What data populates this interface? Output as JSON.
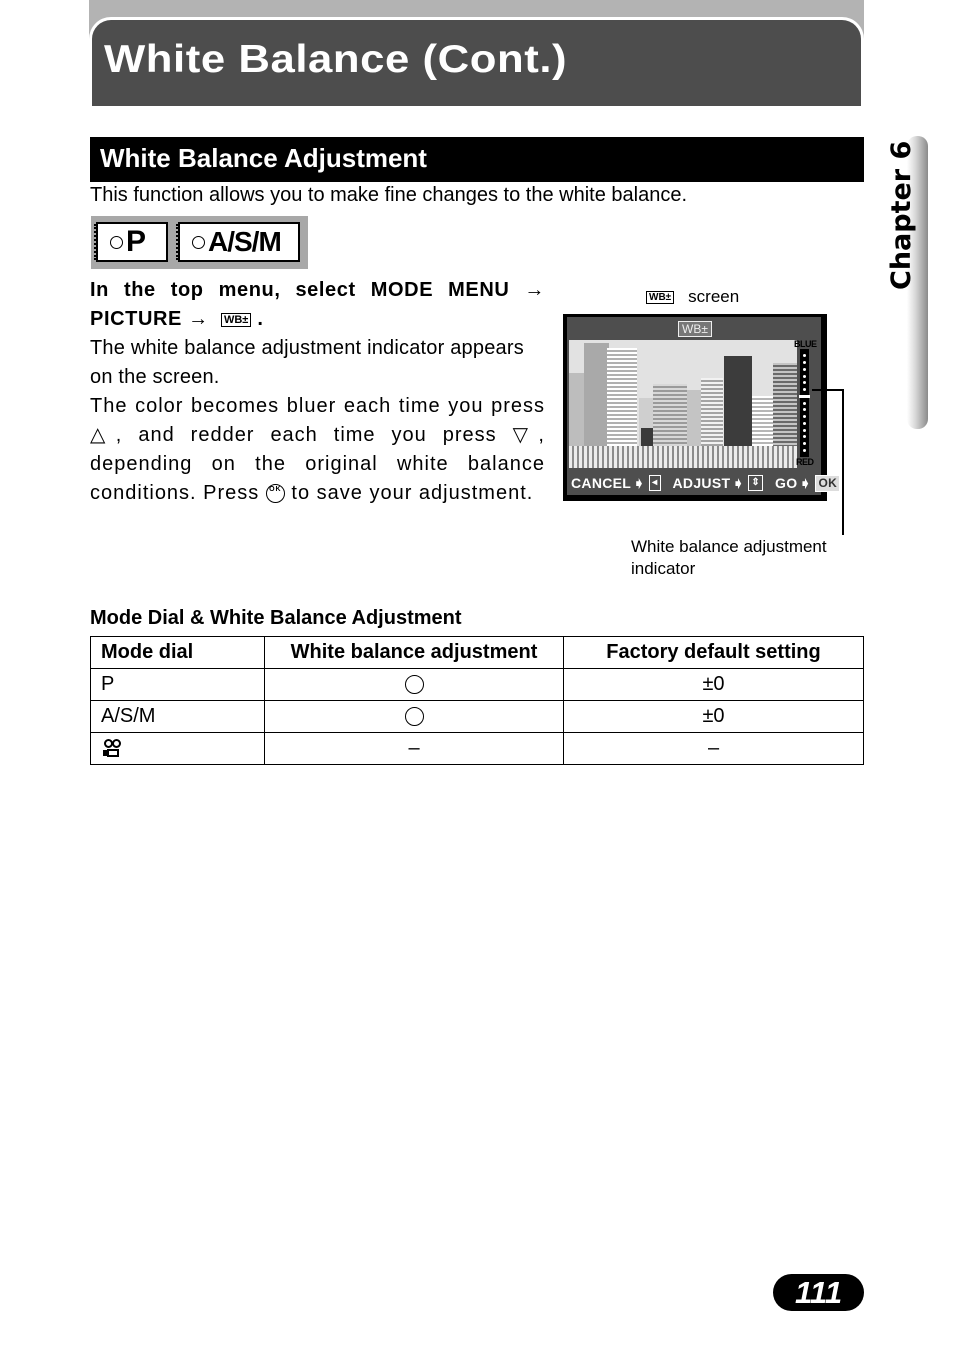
{
  "header": {
    "title": "White Balance (Cont.)"
  },
  "section": {
    "heading": "White Balance Adjustment",
    "intro": "This function allows you to make fine changes to the white balance."
  },
  "modes": {
    "badges": [
      "P",
      "A/S/M"
    ]
  },
  "instructions": {
    "line1": "In the top menu, select MODE MENU",
    "line2": "PICTURE",
    "arrow": "→",
    "period": ".",
    "wb_icon_label": "WB±",
    "para1": "The white balance adjustment indicator appears on the screen.",
    "para2_a": "The color becomes bluer each time you press",
    "up_triangle": "△",
    "para2_b": ", and redder each time you press",
    "down_triangle": "▽",
    "para2_c": ", depending on the original white balance conditions. Press",
    "ok_icon_label": "OK",
    "para2_d": "to save your adjustment."
  },
  "figure": {
    "caption_icon": "WB±",
    "caption": "screen",
    "lcd": {
      "top_icon": "WB±",
      "scale_top": "BLUE",
      "scale_bottom": "RED",
      "scale_position": 0,
      "cancel": "CANCEL",
      "adjust": "ADJUST",
      "go": "GO",
      "ok": "OK"
    },
    "callout": "White balance adjustment indicator"
  },
  "table": {
    "title": "Mode Dial & White Balance Adjustment",
    "headers": [
      "Mode dial",
      "White balance adjustment",
      "Factory default setting"
    ],
    "rows": [
      {
        "mode": "P",
        "adjust": "circle",
        "default": "±0"
      },
      {
        "mode": "A/S/M",
        "adjust": "circle",
        "default": "±0"
      },
      {
        "mode": "movie-icon",
        "adjust": "–",
        "default": "–"
      }
    ]
  },
  "chapter": {
    "label": "Chapter 6"
  },
  "page": {
    "number": "111"
  }
}
